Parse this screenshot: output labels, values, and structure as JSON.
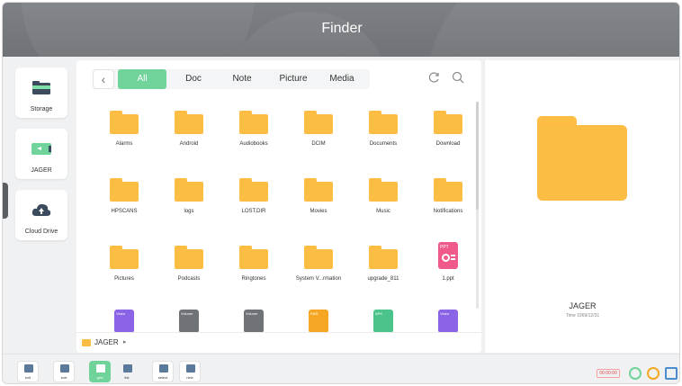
{
  "window": {
    "title": "Finder"
  },
  "sidebar": {
    "items": [
      {
        "label": "Storage",
        "icon": "storage-icon"
      },
      {
        "label": "JAGER",
        "icon": "usb-drive-icon"
      },
      {
        "label": "Cloud Drive",
        "icon": "cloud-upload-icon"
      }
    ]
  },
  "toolbar": {
    "back_icon": "chevron-left-icon",
    "tabs": [
      {
        "label": "All",
        "active": true
      },
      {
        "label": "Doc",
        "active": false
      },
      {
        "label": "Note",
        "active": false
      },
      {
        "label": "Picture",
        "active": false
      },
      {
        "label": "Media",
        "active": false
      }
    ],
    "refresh_icon": "refresh-icon",
    "search_icon": "search-icon"
  },
  "files": [
    {
      "name": "Alarms",
      "type": "folder"
    },
    {
      "name": "Android",
      "type": "folder"
    },
    {
      "name": "Audiobooks",
      "type": "folder"
    },
    {
      "name": "DCIM",
      "type": "folder"
    },
    {
      "name": "Documents",
      "type": "folder"
    },
    {
      "name": "Download",
      "type": "folder"
    },
    {
      "name": "HPSCANS",
      "type": "folder"
    },
    {
      "name": "logs",
      "type": "folder"
    },
    {
      "name": "LOST.DIR",
      "type": "folder"
    },
    {
      "name": "Movies",
      "type": "folder"
    },
    {
      "name": "Music",
      "type": "folder"
    },
    {
      "name": "Notifications",
      "type": "folder"
    },
    {
      "name": "Pictures",
      "type": "folder"
    },
    {
      "name": "Podcasts",
      "type": "folder"
    },
    {
      "name": "Ringtones",
      "type": "folder"
    },
    {
      "name": "System V...rmation",
      "type": "folder"
    },
    {
      "name": "upgrade_811",
      "type": "folder"
    },
    {
      "name": "1.ppt",
      "type": "ppt",
      "badge": "PPT"
    },
    {
      "name": "",
      "type": "video",
      "badge": "Video"
    },
    {
      "name": "",
      "type": "volume",
      "badge": "Volume"
    },
    {
      "name": "",
      "type": "volume",
      "badge": "Volume"
    },
    {
      "name": "",
      "type": "rar",
      "badge": "RAR"
    },
    {
      "name": "",
      "type": "apk",
      "badge": "APK"
    },
    {
      "name": "",
      "type": "video",
      "badge": "Video"
    }
  ],
  "path": {
    "segments": [
      "JAGER"
    ],
    "caret": "▸"
  },
  "preview": {
    "name": "JAGER",
    "time": "Time 1969/12/31"
  },
  "bottom": {
    "buttons": [
      {
        "label": "exit",
        "active": false
      },
      {
        "label": "sort",
        "active": false
      },
      {
        "label": "grid",
        "active": true
      },
      {
        "label": "list",
        "active": false
      },
      {
        "label": "select",
        "active": false
      },
      {
        "label": "new",
        "active": false
      }
    ],
    "record_time": "00:00:00"
  },
  "colors": {
    "accent": "#6fd39a",
    "folder": "#fbbd43",
    "ppt": "#f05a8a",
    "video": "#8a63e6",
    "volume": "#6f7377",
    "rar": "#f5a623",
    "apk": "#4cc38a"
  }
}
